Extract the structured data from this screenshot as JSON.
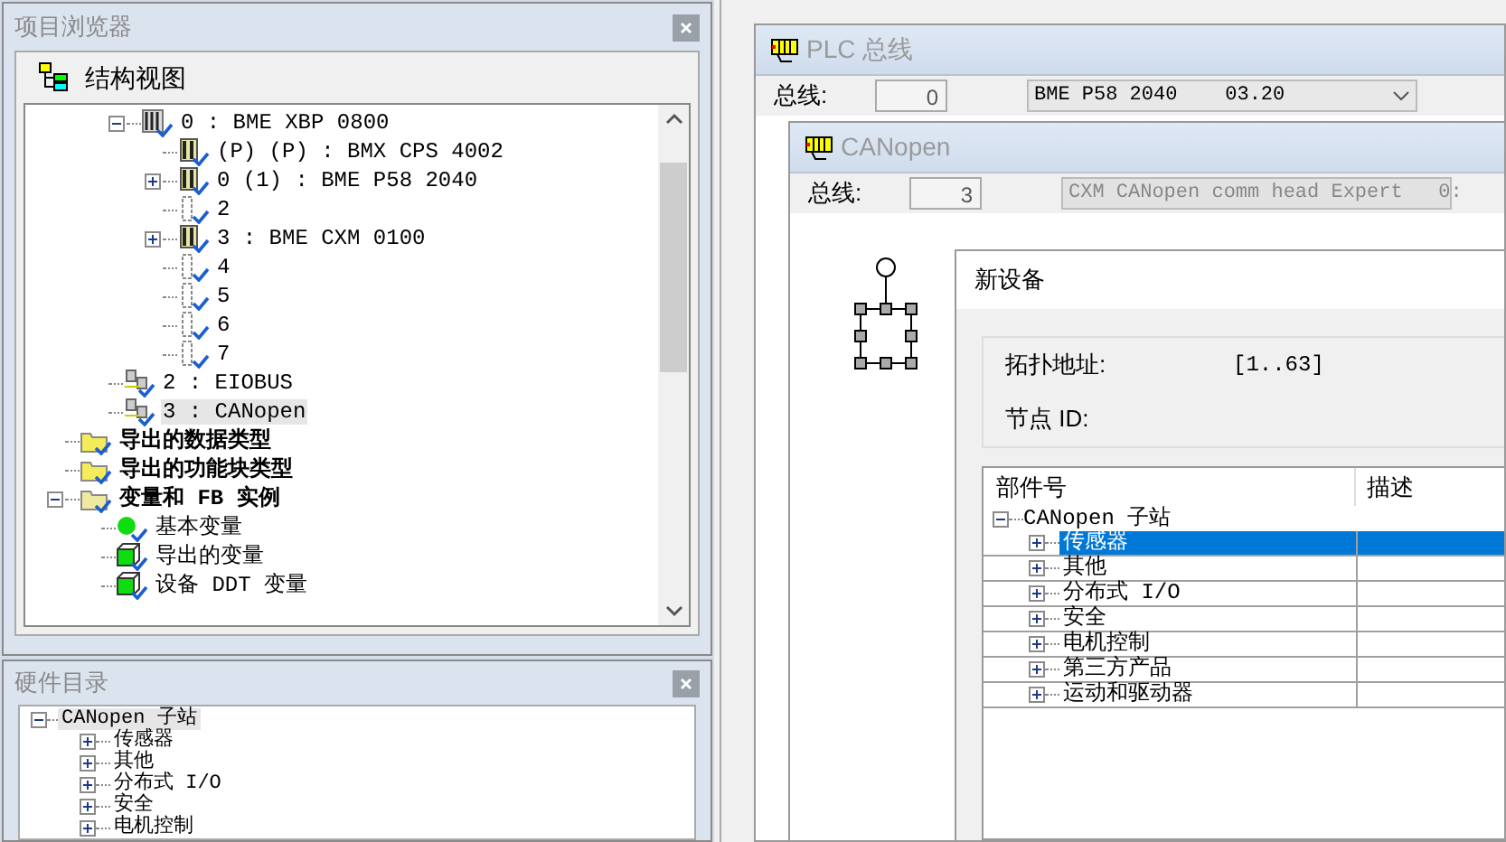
{
  "project_browser": {
    "title": "项目浏览器",
    "view_label": "结构视图",
    "station_items": [
      {
        "label": "0 : BME XBP 0800",
        "kind": "rack",
        "expanded": true,
        "children": [
          {
            "label": "(P) (P) : BMX CPS 4002",
            "kind": "module"
          },
          {
            "label": "0 (1) : BME P58 2040",
            "kind": "module",
            "expanded": false
          },
          {
            "label": "2",
            "kind": "slot"
          },
          {
            "label": "3 : BME CXM 0100",
            "kind": "module",
            "expanded": false
          },
          {
            "label": "4",
            "kind": "slot"
          },
          {
            "label": "5",
            "kind": "slot"
          },
          {
            "label": "6",
            "kind": "slot"
          },
          {
            "label": "7",
            "kind": "slot"
          }
        ]
      },
      {
        "label": "2 : EIOBUS",
        "kind": "bus",
        "selected": false
      },
      {
        "label": "3 : CANopen",
        "kind": "bus",
        "selected": true
      }
    ],
    "folder_items": [
      {
        "label": "导出的数据类型",
        "kind": "folder"
      },
      {
        "label": "导出的功能块类型",
        "kind": "folder"
      },
      {
        "label": "变量和 FB 实例",
        "kind": "folder-open",
        "expanded": true,
        "children": [
          {
            "label": "基本变量",
            "kind": "ball"
          },
          {
            "label": "导出的变量",
            "kind": "cube"
          },
          {
            "label": "设备 DDT 变量",
            "kind": "cube"
          }
        ]
      }
    ]
  },
  "hardware_catalog": {
    "title": "硬件目录",
    "root": {
      "label": "CANopen 子站",
      "expanded": true,
      "selected": true,
      "children": [
        {
          "label": "传感器",
          "expanded": false,
          "selected": false
        },
        {
          "label": "其他",
          "expanded": false,
          "selected": false
        },
        {
          "label": "分布式 I/O",
          "expanded": false,
          "selected": false
        },
        {
          "label": "安全",
          "expanded": false,
          "selected": false
        },
        {
          "label": "电机控制",
          "expanded": false,
          "selected": false
        }
      ]
    }
  },
  "plc_bus_window": {
    "title": "PLC 总线",
    "bus_label": "总线:",
    "bus_value": "0",
    "module_select": "BME P58 2040    03.20"
  },
  "canopen_window": {
    "title": "CANopen",
    "bus_label": "总线:",
    "bus_value": "3",
    "module_select": "CXM CANopen comm head Expert   0:"
  },
  "new_device_dialog": {
    "title": "新设备",
    "topology_label": "拓扑地址:",
    "topology_range": "[1..63]",
    "node_id_label": "节点 ID:",
    "columns": [
      "部件号",
      "描述"
    ],
    "root": {
      "label": "CANopen 子站",
      "expanded": true,
      "children": [
        {
          "label": "传感器",
          "expanded": false,
          "selected": true
        },
        {
          "label": "其他",
          "expanded": false,
          "selected": false
        },
        {
          "label": "分布式 I/O",
          "expanded": false,
          "selected": false
        },
        {
          "label": "安全",
          "expanded": false,
          "selected": false
        },
        {
          "label": "电机控制",
          "expanded": false,
          "selected": false
        },
        {
          "label": "第三方产品",
          "expanded": false,
          "selected": false
        },
        {
          "label": "运动和驱动器",
          "expanded": false,
          "selected": false
        }
      ]
    }
  }
}
